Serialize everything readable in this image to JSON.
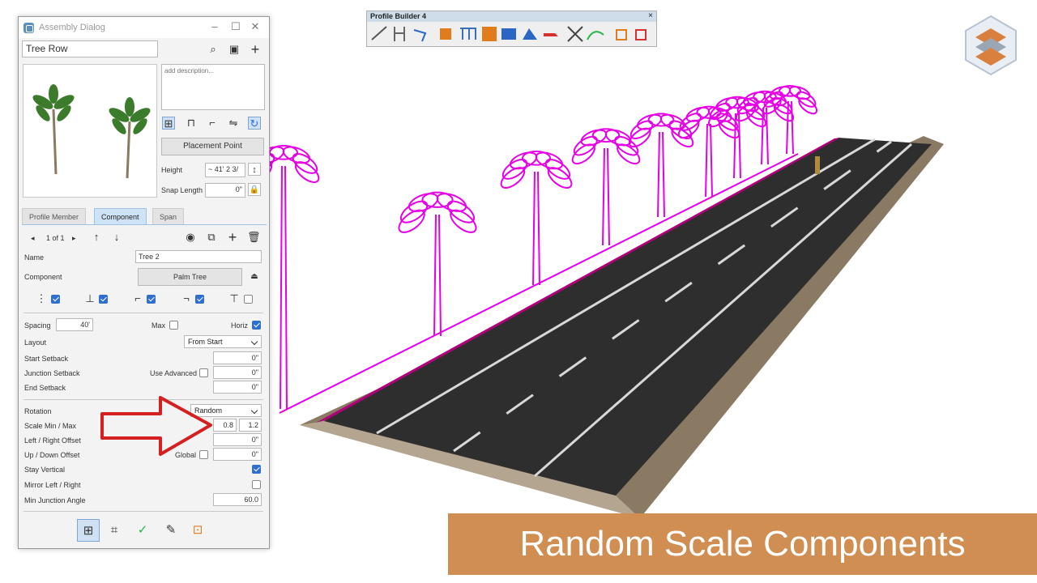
{
  "dialog": {
    "title": "Assembly Dialog",
    "name_value": "Tree Row",
    "description_placeholder": "add description...",
    "placement_point_label": "Placement Point",
    "height_label": "Height",
    "height_value": "~ 41' 2 3/",
    "snap_length_label": "Snap Length",
    "snap_length_value": "0\"",
    "tabs": [
      "Profile Member",
      "Component",
      "Span"
    ],
    "pager": "1 of 1",
    "component": {
      "name_label": "Name",
      "name_value": "Tree 2",
      "component_label": "Component",
      "component_value": "Palm Tree",
      "spacing_label": "Spacing",
      "spacing_value": "40'",
      "max_label": "Max",
      "horiz_label": "Horiz",
      "layout_label": "Layout",
      "layout_value": "From Start",
      "start_setback_label": "Start Setback",
      "start_setback_value": "0\"",
      "junction_setback_label": "Junction Setback",
      "use_advanced_label": "Use Advanced",
      "junction_setback_value": "0\"",
      "end_setback_label": "End Setback",
      "end_setback_value": "0\"",
      "rotation_label": "Rotation",
      "rotation_value": "Random",
      "scale_label": "Scale Min / Max",
      "scale_min": "0.8",
      "scale_max": "1.2",
      "lr_offset_label": "Left / Right Offset",
      "lr_offset_value": "0\"",
      "ud_offset_label": "Up / Down Offset",
      "global_label": "Global",
      "ud_offset_value": "0\"",
      "stay_vertical_label": "Stay Vertical",
      "mirror_label": "Mirror Left / Right",
      "min_junction_label": "Min Junction Angle",
      "min_junction_value": "60.0"
    }
  },
  "toolbar": {
    "title": "Profile Builder 4"
  },
  "banner": {
    "text": "Random Scale Components"
  },
  "colors": {
    "accent": "#2f6fd0",
    "magenta": "#e600e6",
    "banner": "#d08e52",
    "arrow": "#d42020"
  }
}
